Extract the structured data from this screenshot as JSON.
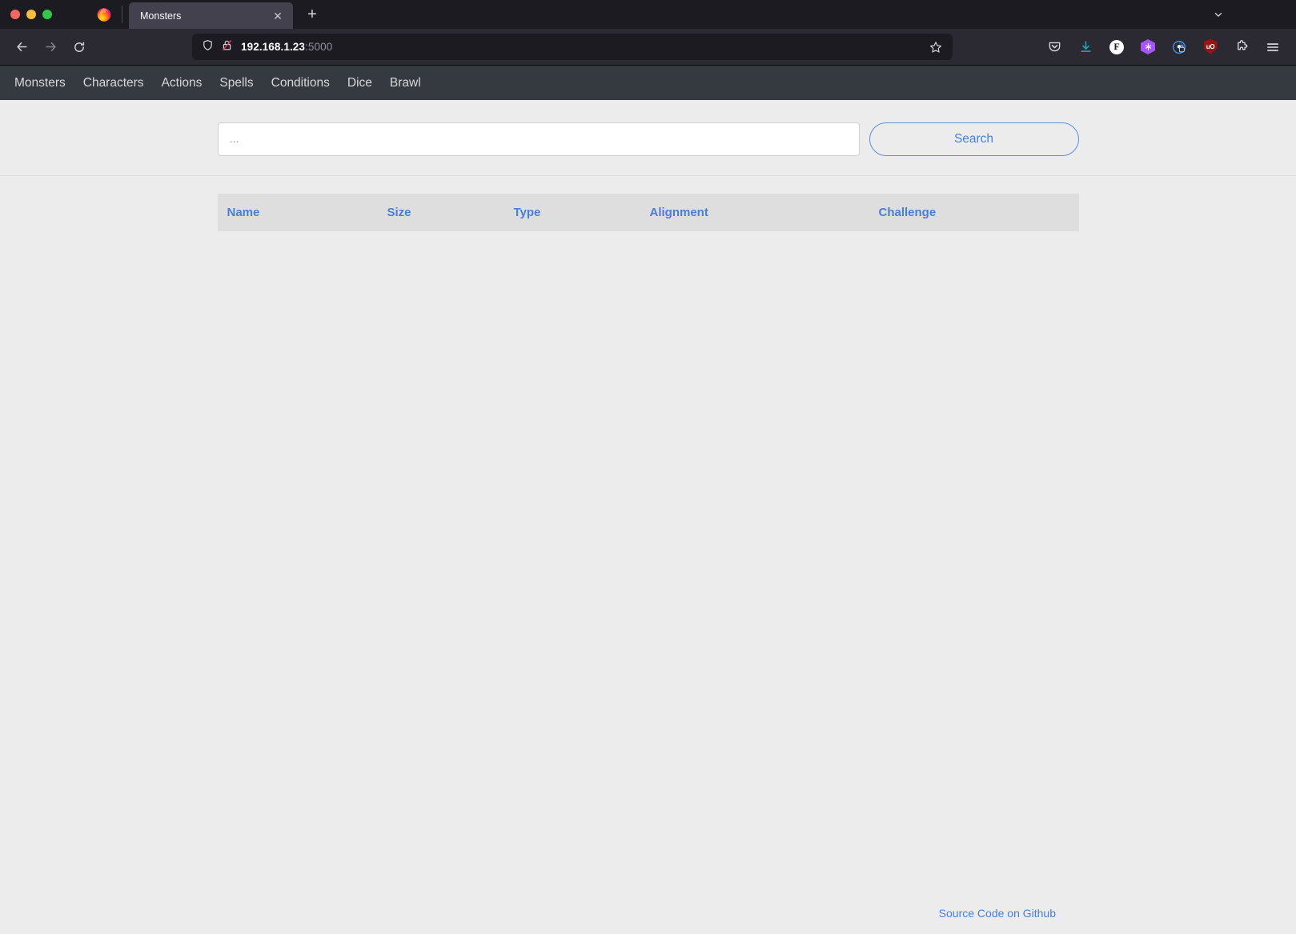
{
  "browser": {
    "window_controls": [
      "close",
      "minimize",
      "maximize"
    ],
    "app_icon": "firefox-logo-icon",
    "tab": {
      "title": "Monsters",
      "close_label": "✕"
    },
    "new_tab_label": "+",
    "all_tabs_label": "⌄",
    "nav": {
      "back_label": "←",
      "forward_label": "→",
      "reload_label": "⟳"
    },
    "urlbar": {
      "host": "192.168.1.23",
      "port": ":5000",
      "shield_icon": "shield-icon",
      "lock_icon": "lock-crossed-out-icon",
      "bookmark_icon": "star-icon"
    },
    "toolbar_icons": [
      {
        "name": "pocket-icon",
        "label": ""
      },
      {
        "name": "downloads-icon",
        "label": ""
      },
      {
        "name": "firefox-relay-icon",
        "label": "F"
      },
      {
        "name": "bitwarden-icon",
        "label": ""
      },
      {
        "name": "privacy-badger-icon",
        "label": ""
      },
      {
        "name": "ublock-origin-icon",
        "label": "uO"
      },
      {
        "name": "extensions-puzzle-icon",
        "label": ""
      },
      {
        "name": "app-menu-icon",
        "label": ""
      }
    ]
  },
  "site": {
    "nav_items": [
      {
        "label": "Monsters"
      },
      {
        "label": "Characters"
      },
      {
        "label": "Actions"
      },
      {
        "label": "Spells"
      },
      {
        "label": "Conditions"
      },
      {
        "label": "Dice"
      },
      {
        "label": "Brawl"
      }
    ],
    "search": {
      "value": "",
      "placeholder": "...",
      "button_label": "Search"
    },
    "table": {
      "columns": [
        {
          "label": "Name"
        },
        {
          "label": "Size"
        },
        {
          "label": "Type"
        },
        {
          "label": "Alignment"
        },
        {
          "label": "Challenge"
        }
      ],
      "rows": []
    },
    "footer": {
      "link_label": "Source Code on Github"
    }
  },
  "colors": {
    "chrome_bg": "#1c1b22",
    "toolbar_bg": "#2b2a33",
    "tab_active": "#42414d",
    "site_nav_bg": "#343a40",
    "page_bg": "#ececec",
    "table_head_bg": "#dedede",
    "link_blue": "#4a7ed6"
  }
}
